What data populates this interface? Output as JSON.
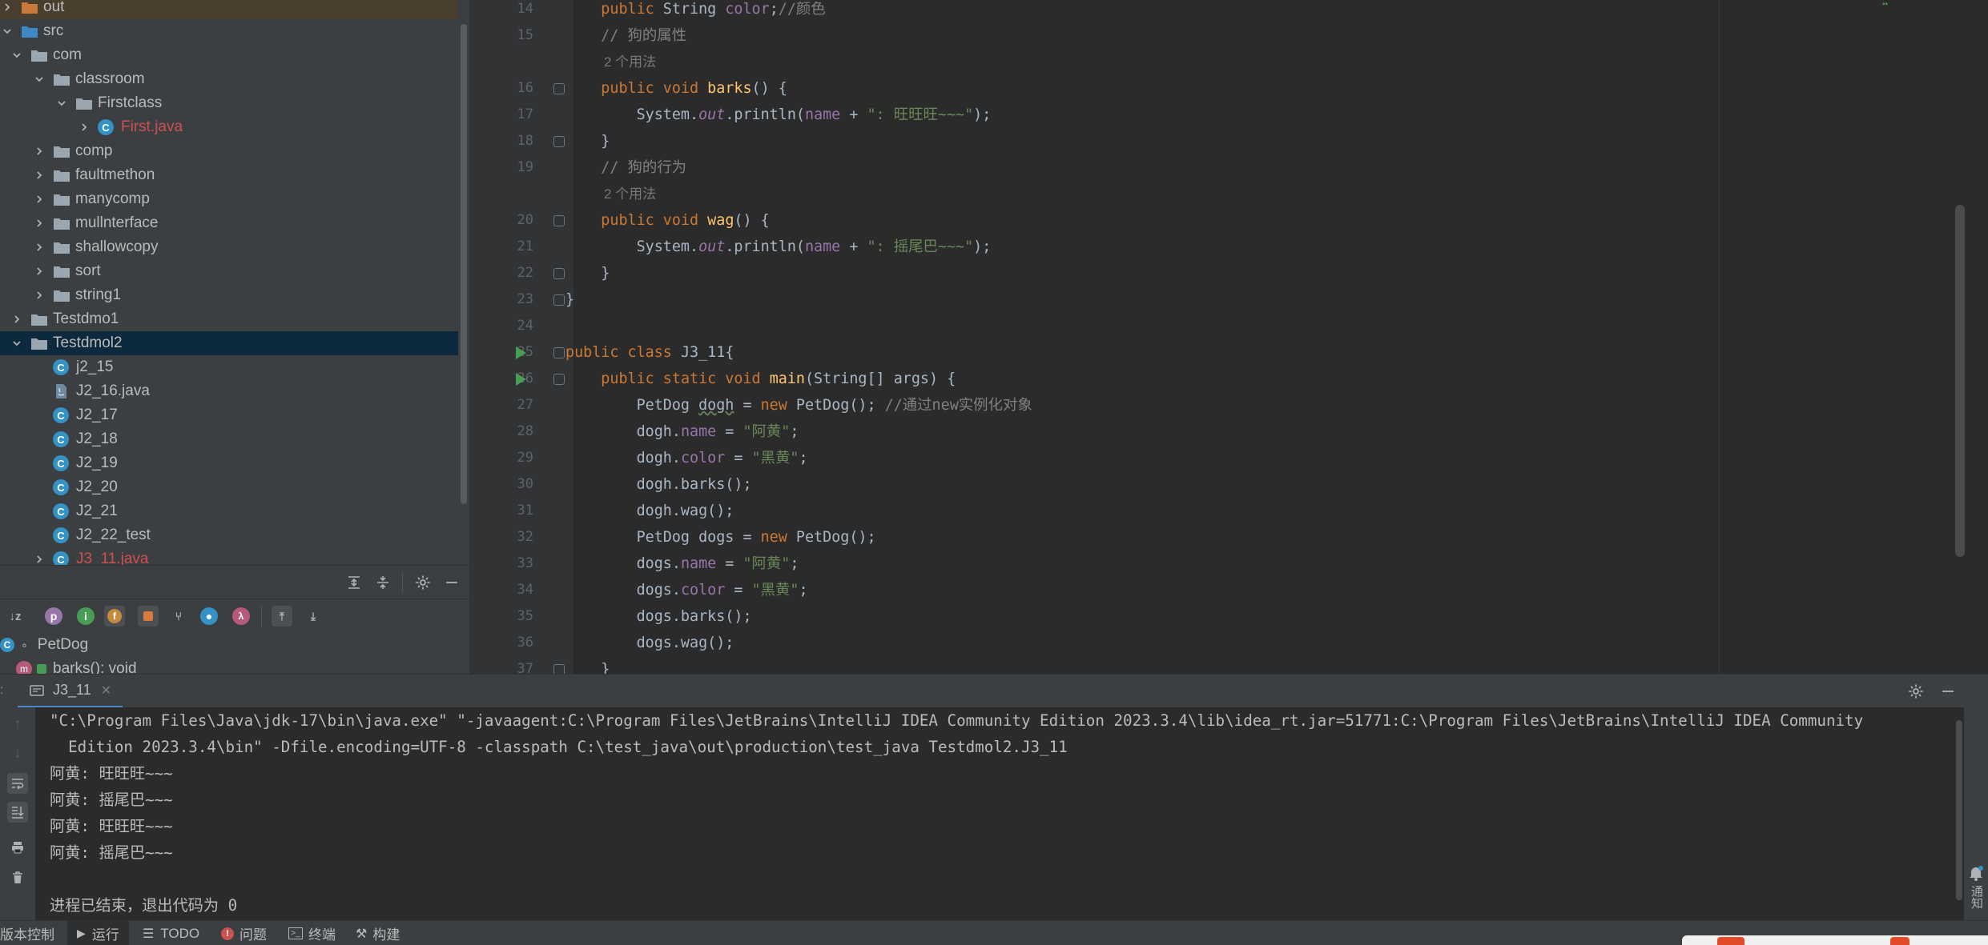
{
  "project_tree": [
    {
      "label": "out",
      "kind": "folder-orange",
      "indent": 0,
      "chevron": "right",
      "style": "cut"
    },
    {
      "label": "src",
      "kind": "folder-blue",
      "indent": 0,
      "chevron": "down"
    },
    {
      "label": "com",
      "kind": "folder",
      "indent": 1,
      "chevron": "down"
    },
    {
      "label": "classroom",
      "kind": "folder",
      "indent": 2,
      "chevron": "down"
    },
    {
      "label": "Firstclass",
      "kind": "folder",
      "indent": 3,
      "chevron": "down"
    },
    {
      "label": "First.java",
      "kind": "class",
      "indent": 4,
      "chevron": "right",
      "style": "error"
    },
    {
      "label": "comp",
      "kind": "folder",
      "indent": 2,
      "chevron": "right"
    },
    {
      "label": "faultmethon",
      "kind": "folder",
      "indent": 2,
      "chevron": "right"
    },
    {
      "label": "manycomp",
      "kind": "folder",
      "indent": 2,
      "chevron": "right"
    },
    {
      "label": "mullnterface",
      "kind": "folder",
      "indent": 2,
      "chevron": "right"
    },
    {
      "label": "shallowcopy",
      "kind": "folder",
      "indent": 2,
      "chevron": "right"
    },
    {
      "label": "sort",
      "kind": "folder",
      "indent": 2,
      "chevron": "right"
    },
    {
      "label": "string1",
      "kind": "folder",
      "indent": 2,
      "chevron": "right"
    },
    {
      "label": "Testdmo1",
      "kind": "folder",
      "indent": 1,
      "chevron": "right"
    },
    {
      "label": "Testdmol2",
      "kind": "folder",
      "indent": 1,
      "chevron": "down",
      "style": "selected"
    },
    {
      "label": "j2_15",
      "kind": "class",
      "indent": 2,
      "chevron": "none"
    },
    {
      "label": "J2_16.java",
      "kind": "javafile",
      "indent": 2,
      "chevron": "none"
    },
    {
      "label": "J2_17",
      "kind": "class",
      "indent": 2,
      "chevron": "none"
    },
    {
      "label": "J2_18",
      "kind": "class",
      "indent": 2,
      "chevron": "none"
    },
    {
      "label": "J2_19",
      "kind": "class",
      "indent": 2,
      "chevron": "none"
    },
    {
      "label": "J2_20",
      "kind": "class",
      "indent": 2,
      "chevron": "none"
    },
    {
      "label": "J2_21",
      "kind": "class",
      "indent": 2,
      "chevron": "none"
    },
    {
      "label": "J2_22_test",
      "kind": "class",
      "indent": 2,
      "chevron": "none"
    },
    {
      "label": "J3_11.java",
      "kind": "class",
      "indent": 2,
      "chevron": "right",
      "style": "error"
    }
  ],
  "structure": {
    "root": "PetDog",
    "member": "barks(): void"
  },
  "editor": {
    "lines": [
      {
        "n": "14",
        "hint": null,
        "html": "    <span class='kw'>public</span> String <span class='fld'>color</span>;<span class='cm'>//颜色</span>"
      },
      {
        "n": "15",
        "hint": null,
        "html": "    <span class='cm'>// 狗的属性</span>"
      },
      {
        "n": null,
        "hint": "2 个用法"
      },
      {
        "n": "16",
        "fold": true,
        "html": "    <span class='kw'>public void</span> <span class='fn'>barks</span>() {"
      },
      {
        "n": "17",
        "html": "        System.<span class='st'>out</span>.println(<span class='fld'>name</span> + <span class='str'>\": 旺旺旺~~~\"</span>);"
      },
      {
        "n": "18",
        "fold": true,
        "html": "    }"
      },
      {
        "n": "19",
        "html": "    <span class='cm'>// 狗的行为</span>"
      },
      {
        "n": null,
        "hint": "2 个用法"
      },
      {
        "n": "20",
        "fold": true,
        "html": "    <span class='kw'>public void</span> <span class='fn'>wag</span>() {"
      },
      {
        "n": "21",
        "html": "        System.<span class='st'>out</span>.println(<span class='fld'>name</span> + <span class='str'>\": 摇尾巴~~~\"</span>);"
      },
      {
        "n": "22",
        "fold": true,
        "html": "    }"
      },
      {
        "n": "23",
        "fold": true,
        "html": "}"
      },
      {
        "n": "24",
        "html": ""
      },
      {
        "n": "25",
        "fold": true,
        "run": true,
        "html": "<span class='kw'>public class</span> J3_11{"
      },
      {
        "n": "26",
        "fold": true,
        "run": true,
        "html": "    <span class='kw'>public static void</span> <span class='fn'>main</span>(String[] args) {"
      },
      {
        "n": "27",
        "html": "        PetDog <span class='ul'>dogh</span> = <span class='kw'>new</span> PetDog(); <span class='cm'>//通过new实例化对象</span>"
      },
      {
        "n": "28",
        "html": "        dogh.<span class='fld'>name</span> = <span class='str'>\"阿黄\"</span>;"
      },
      {
        "n": "29",
        "html": "        dogh.<span class='fld'>color</span> = <span class='str'>\"黑黄\"</span>;"
      },
      {
        "n": "30",
        "html": "        dogh.barks();"
      },
      {
        "n": "31",
        "html": "        dogh.wag();"
      },
      {
        "n": "32",
        "html": "        PetDog dogs = <span class='kw'>new</span> PetDog();"
      },
      {
        "n": "33",
        "html": "        dogs.<span class='fld'>name</span> = <span class='str'>\"阿黄\"</span>;"
      },
      {
        "n": "34",
        "html": "        dogs.<span class='fld'>color</span> = <span class='str'>\"黑黄\"</span>;"
      },
      {
        "n": "35",
        "html": "        dogs.barks();"
      },
      {
        "n": "36",
        "html": "        dogs.wag();"
      },
      {
        "n": "37",
        "fold": true,
        "html": "    }"
      }
    ]
  },
  "run_panel": {
    "tab_label": "J3_11",
    "console_lines": [
      "\"C:\\Program Files\\Java\\jdk-17\\bin\\java.exe\" \"-javaagent:C:\\Program Files\\JetBrains\\IntelliJ IDEA Community Edition 2023.3.4\\lib\\idea_rt.jar=51771:C:\\Program Files\\JetBrains\\IntelliJ IDEA Community",
      "  Edition 2023.3.4\\bin\" -Dfile.encoding=UTF-8 -classpath C:\\test_java\\out\\production\\test_java Testdmol2.J3_11",
      "阿黄: 旺旺旺~~~",
      "阿黄: 摇尾巴~~~",
      "阿黄: 旺旺旺~~~",
      "阿黄: 摇尾巴~~~",
      "",
      "进程已结束，退出代码为 0"
    ]
  },
  "statusbar": {
    "vcs": "版本控制",
    "run": "运行",
    "todo": "TODO",
    "problems": "问题",
    "terminal": "终端",
    "build": "构建"
  },
  "notifications_label": "通知",
  "colors": {
    "keyword": "#cc7832",
    "string": "#6a8759",
    "comment": "#808080",
    "field": "#9876aa",
    "method": "#ffc66d",
    "class_icon": "#3592c4",
    "selection": "#0d293e"
  }
}
